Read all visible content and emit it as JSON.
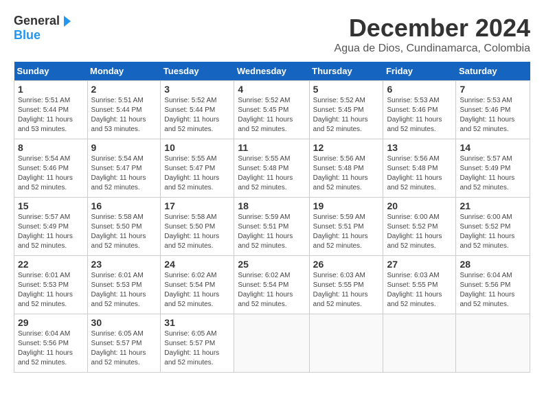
{
  "app": {
    "logo_general": "General",
    "logo_blue": "Blue"
  },
  "title": {
    "month_year": "December 2024",
    "location": "Agua de Dios, Cundinamarca, Colombia"
  },
  "headers": [
    "Sunday",
    "Monday",
    "Tuesday",
    "Wednesday",
    "Thursday",
    "Friday",
    "Saturday"
  ],
  "weeks": [
    [
      {
        "day": "1",
        "sunrise": "5:51 AM",
        "sunset": "5:44 PM",
        "daylight": "11 hours and 53 minutes."
      },
      {
        "day": "2",
        "sunrise": "5:51 AM",
        "sunset": "5:44 PM",
        "daylight": "11 hours and 53 minutes."
      },
      {
        "day": "3",
        "sunrise": "5:52 AM",
        "sunset": "5:44 PM",
        "daylight": "11 hours and 52 minutes."
      },
      {
        "day": "4",
        "sunrise": "5:52 AM",
        "sunset": "5:45 PM",
        "daylight": "11 hours and 52 minutes."
      },
      {
        "day": "5",
        "sunrise": "5:52 AM",
        "sunset": "5:45 PM",
        "daylight": "11 hours and 52 minutes."
      },
      {
        "day": "6",
        "sunrise": "5:53 AM",
        "sunset": "5:46 PM",
        "daylight": "11 hours and 52 minutes."
      },
      {
        "day": "7",
        "sunrise": "5:53 AM",
        "sunset": "5:46 PM",
        "daylight": "11 hours and 52 minutes."
      }
    ],
    [
      {
        "day": "8",
        "sunrise": "5:54 AM",
        "sunset": "5:46 PM",
        "daylight": "11 hours and 52 minutes."
      },
      {
        "day": "9",
        "sunrise": "5:54 AM",
        "sunset": "5:47 PM",
        "daylight": "11 hours and 52 minutes."
      },
      {
        "day": "10",
        "sunrise": "5:55 AM",
        "sunset": "5:47 PM",
        "daylight": "11 hours and 52 minutes."
      },
      {
        "day": "11",
        "sunrise": "5:55 AM",
        "sunset": "5:48 PM",
        "daylight": "11 hours and 52 minutes."
      },
      {
        "day": "12",
        "sunrise": "5:56 AM",
        "sunset": "5:48 PM",
        "daylight": "11 hours and 52 minutes."
      },
      {
        "day": "13",
        "sunrise": "5:56 AM",
        "sunset": "5:48 PM",
        "daylight": "11 hours and 52 minutes."
      },
      {
        "day": "14",
        "sunrise": "5:57 AM",
        "sunset": "5:49 PM",
        "daylight": "11 hours and 52 minutes."
      }
    ],
    [
      {
        "day": "15",
        "sunrise": "5:57 AM",
        "sunset": "5:49 PM",
        "daylight": "11 hours and 52 minutes."
      },
      {
        "day": "16",
        "sunrise": "5:58 AM",
        "sunset": "5:50 PM",
        "daylight": "11 hours and 52 minutes."
      },
      {
        "day": "17",
        "sunrise": "5:58 AM",
        "sunset": "5:50 PM",
        "daylight": "11 hours and 52 minutes."
      },
      {
        "day": "18",
        "sunrise": "5:59 AM",
        "sunset": "5:51 PM",
        "daylight": "11 hours and 52 minutes."
      },
      {
        "day": "19",
        "sunrise": "5:59 AM",
        "sunset": "5:51 PM",
        "daylight": "11 hours and 52 minutes."
      },
      {
        "day": "20",
        "sunrise": "6:00 AM",
        "sunset": "5:52 PM",
        "daylight": "11 hours and 52 minutes."
      },
      {
        "day": "21",
        "sunrise": "6:00 AM",
        "sunset": "5:52 PM",
        "daylight": "11 hours and 52 minutes."
      }
    ],
    [
      {
        "day": "22",
        "sunrise": "6:01 AM",
        "sunset": "5:53 PM",
        "daylight": "11 hours and 52 minutes."
      },
      {
        "day": "23",
        "sunrise": "6:01 AM",
        "sunset": "5:53 PM",
        "daylight": "11 hours and 52 minutes."
      },
      {
        "day": "24",
        "sunrise": "6:02 AM",
        "sunset": "5:54 PM",
        "daylight": "11 hours and 52 minutes."
      },
      {
        "day": "25",
        "sunrise": "6:02 AM",
        "sunset": "5:54 PM",
        "daylight": "11 hours and 52 minutes."
      },
      {
        "day": "26",
        "sunrise": "6:03 AM",
        "sunset": "5:55 PM",
        "daylight": "11 hours and 52 minutes."
      },
      {
        "day": "27",
        "sunrise": "6:03 AM",
        "sunset": "5:55 PM",
        "daylight": "11 hours and 52 minutes."
      },
      {
        "day": "28",
        "sunrise": "6:04 AM",
        "sunset": "5:56 PM",
        "daylight": "11 hours and 52 minutes."
      }
    ],
    [
      {
        "day": "29",
        "sunrise": "6:04 AM",
        "sunset": "5:56 PM",
        "daylight": "11 hours and 52 minutes."
      },
      {
        "day": "30",
        "sunrise": "6:05 AM",
        "sunset": "5:57 PM",
        "daylight": "11 hours and 52 minutes."
      },
      {
        "day": "31",
        "sunrise": "6:05 AM",
        "sunset": "5:57 PM",
        "daylight": "11 hours and 52 minutes."
      },
      null,
      null,
      null,
      null
    ]
  ],
  "labels": {
    "sunrise": "Sunrise:",
    "sunset": "Sunset:",
    "daylight": "Daylight:"
  }
}
